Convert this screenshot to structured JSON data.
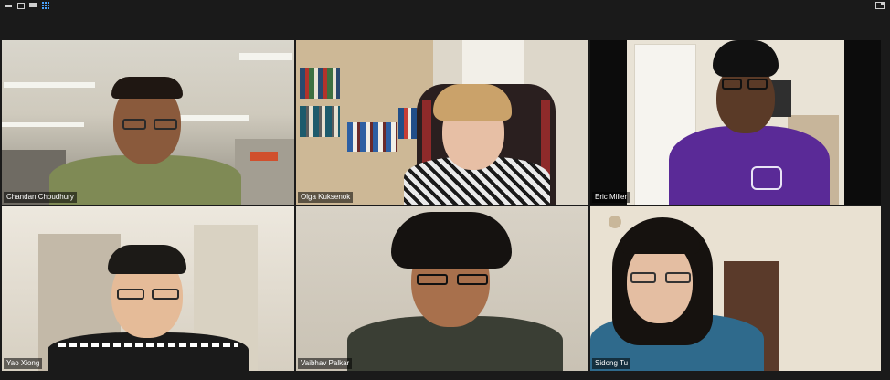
{
  "toolbar": {
    "icons": [
      "minimize-icon",
      "restore-icon",
      "speaker-view-icon",
      "gallery-view-icon",
      "fullscreen-icon"
    ]
  },
  "participants": [
    {
      "name": "Chandan Choudhury",
      "active_speaker": true
    },
    {
      "name": "Olga Kuksenok",
      "active_speaker": false
    },
    {
      "name": "Eric Miller",
      "active_speaker": false
    },
    {
      "name": "Yao Xiong",
      "active_speaker": false
    },
    {
      "name": "Vaibhav Palkar",
      "active_speaker": false
    },
    {
      "name": "Sidong Tu",
      "active_speaker": false
    }
  ],
  "colors": {
    "active_speaker_border": "#c8d94a",
    "gallery_icon": "#4aa3ff",
    "background": "#1a1a1a"
  }
}
